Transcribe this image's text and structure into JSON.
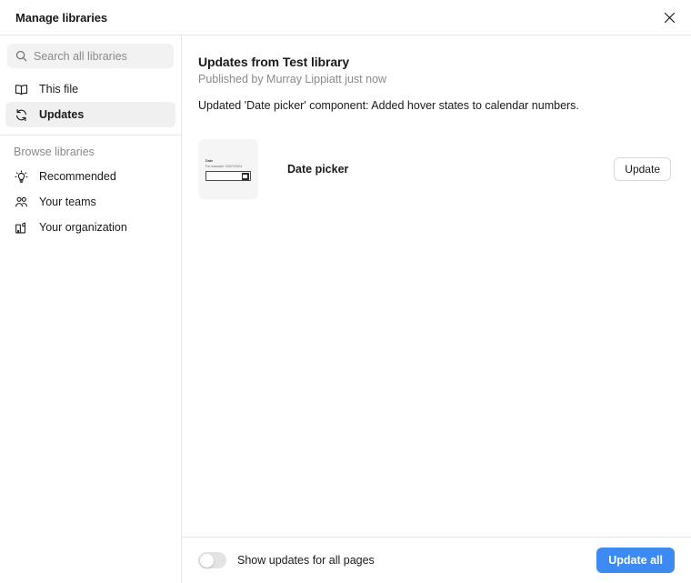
{
  "window": {
    "title": "Manage libraries",
    "close_icon": "close-icon"
  },
  "sidebar": {
    "search": {
      "placeholder": "Search all libraries",
      "value": "",
      "icon": "search-icon"
    },
    "primary_items": [
      {
        "label": "This file",
        "icon": "book-icon",
        "selected": false
      },
      {
        "label": "Updates",
        "icon": "refresh-icon",
        "selected": true
      }
    ],
    "section_label": "Browse libraries",
    "browse_items": [
      {
        "label": "Recommended",
        "icon": "lightbulb-icon"
      },
      {
        "label": "Your teams",
        "icon": "people-icon"
      },
      {
        "label": "Your organization",
        "icon": "building-icon"
      }
    ]
  },
  "main": {
    "title": "Updates from Test library",
    "published": "Published by Murray Lippiatt just now",
    "description": "Updated 'Date picker' component: Added hover states to calendar numbers.",
    "components": [
      {
        "name": "Date picker",
        "update_label": "Update",
        "thumbnail": {
          "label": "Date",
          "hint": "For example: 03/07/2024",
          "calendar_icon": "calendar-icon"
        }
      }
    ]
  },
  "footer": {
    "toggle_label": "Show updates for all pages",
    "toggle_on": false,
    "update_all_label": "Update all"
  },
  "colors": {
    "accent": "#3d8bf2",
    "selected_bg": "#f0f0f0",
    "search_bg": "#f2f2f2",
    "thumb_bg": "#f5f5f5",
    "border": "#e6e6e6",
    "text": "#1a1a1a",
    "muted_text": "#8a8a8a"
  }
}
